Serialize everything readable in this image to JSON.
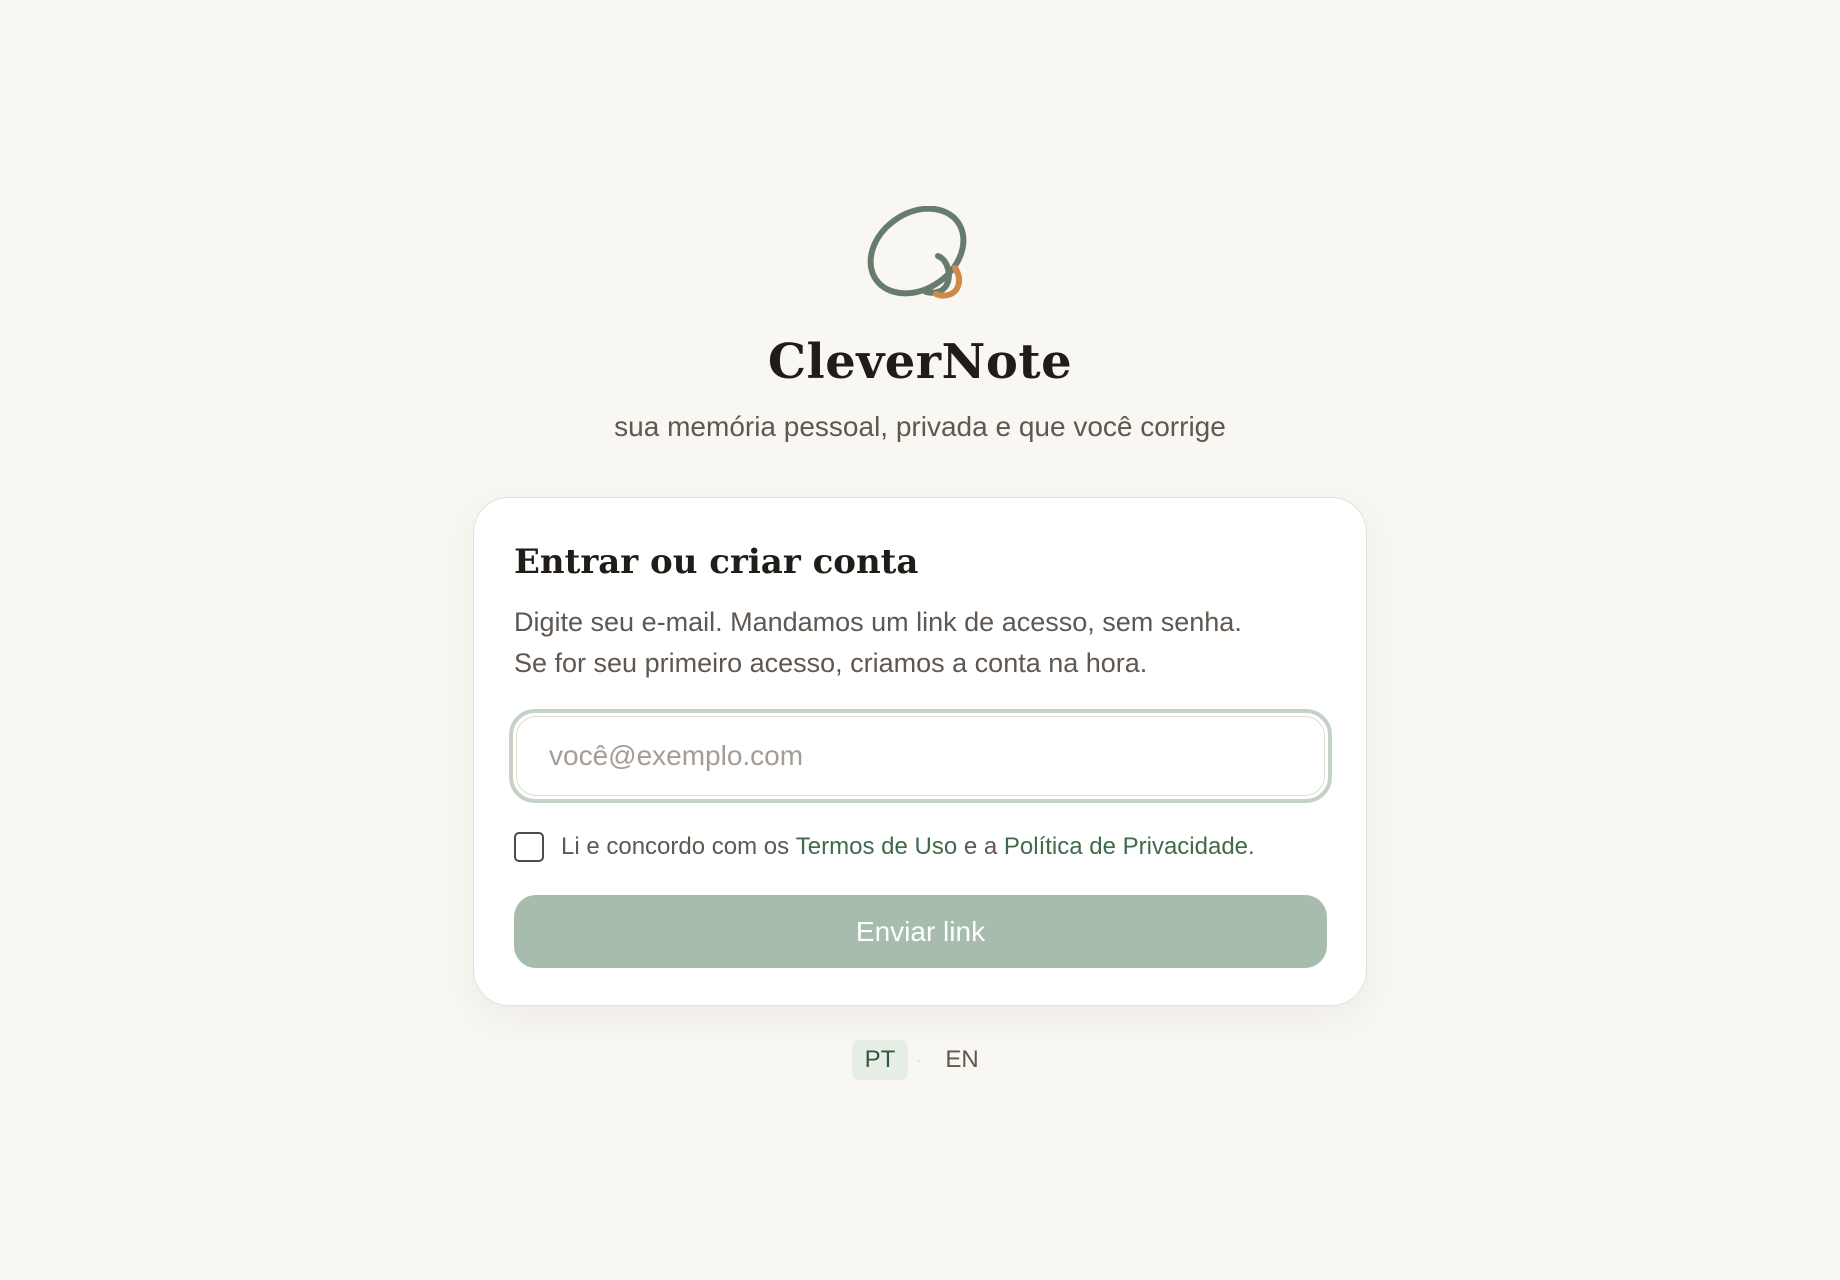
{
  "brand": {
    "name": "CleverNote",
    "tagline": "sua memória pessoal, privada e que você corrige",
    "logo_icon": "orbit-logo-icon",
    "colors": {
      "primary": "#687c6e",
      "accent": "#d0894b"
    }
  },
  "auth_card": {
    "title": "Entrar ou criar conta",
    "description_line1": "Digite seu e-mail. Mandamos um link de acesso, sem senha.",
    "description_line2": "Se for seu primeiro acesso, criamos a conta na hora.",
    "email_placeholder": "você@exemplo.com",
    "email_value": "",
    "consent": {
      "checked": false,
      "prefix": "Li e concordo com os ",
      "terms_link": "Termos de Uso",
      "middle": " e a ",
      "privacy_link": "Política de Privacidade",
      "suffix": "."
    },
    "submit_label": "Enviar link",
    "submit_color": "#a7bcad"
  },
  "language_switcher": {
    "active": "PT",
    "pt_label": "PT",
    "separator": "·",
    "en_label": "EN"
  }
}
